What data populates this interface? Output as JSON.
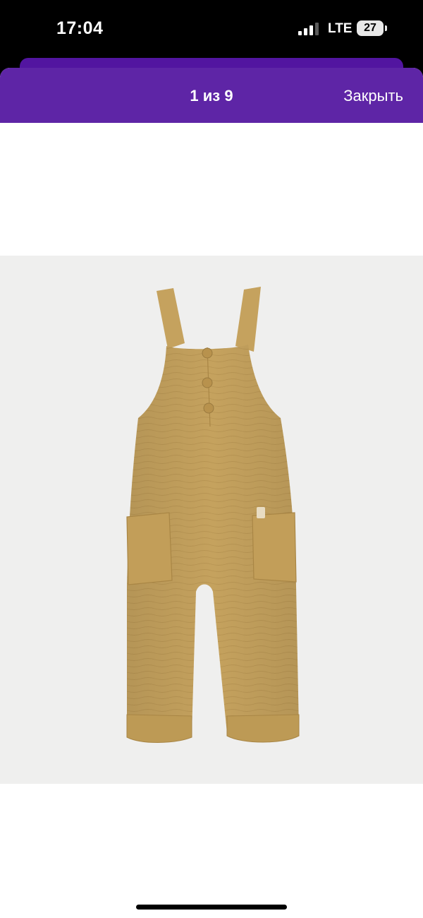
{
  "status_bar": {
    "time": "17:04",
    "network": "LTE",
    "battery": "27"
  },
  "viewer": {
    "counter": "1 из 9",
    "close_label": "Закрыть",
    "accent_color": "#5e25a6"
  },
  "product_image": {
    "alt": "Mustard muslin overalls",
    "garment_color": "#c5a25e",
    "background_color": "#efefee"
  }
}
